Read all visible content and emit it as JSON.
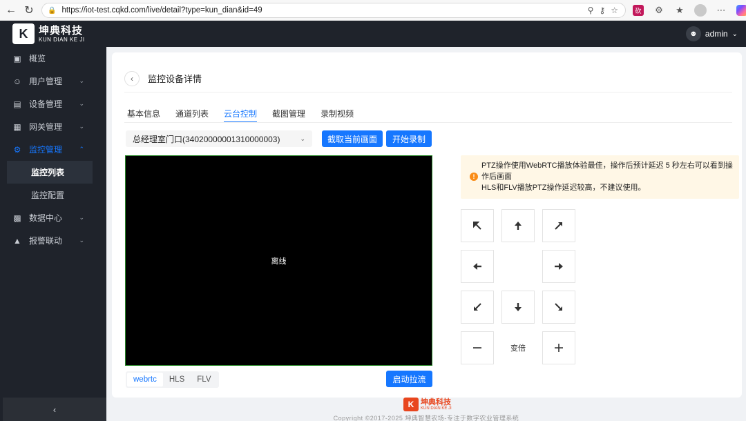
{
  "browser": {
    "url": "https://iot-test.cqkd.com/live/detail?type=kun_dian&id=49",
    "extension_badge": "砍"
  },
  "header": {
    "logo_mark": "K",
    "logo_cn": "坤典科技",
    "logo_en": "KUN DIAN KE JI",
    "user_name": "admin"
  },
  "sidebar": {
    "items": [
      {
        "label": "概览",
        "icon": "dashboard-icon"
      },
      {
        "label": "用户管理",
        "icon": "user-icon"
      },
      {
        "label": "设备管理",
        "icon": "device-icon"
      },
      {
        "label": "网关管理",
        "icon": "gateway-icon"
      },
      {
        "label": "监控管理",
        "icon": "monitor-icon"
      },
      {
        "label": "数据中心",
        "icon": "chart-icon"
      },
      {
        "label": "报警联动",
        "icon": "alarm-icon"
      }
    ],
    "sub_items": [
      "监控列表",
      "监控配置"
    ],
    "collapse": "‹"
  },
  "page": {
    "title": "监控设备详情",
    "tabs": [
      "基本信息",
      "通道列表",
      "云台控制",
      "截图管理",
      "录制视频"
    ],
    "active_tab": "云台控制"
  },
  "controls": {
    "channel_select": "总经理室门口(34020000001310000003)",
    "capture_button": "截取当前画面",
    "record_button": "开始录制",
    "video_status": "离线",
    "protocols": [
      "webrtc",
      "HLS",
      "FLV"
    ],
    "active_protocol": "webrtc",
    "start_stream_button": "启动拉流"
  },
  "alert": {
    "line1": "PTZ操作使用WebRTC播放体验最佳，操作后预计延迟 5 秒左右可以看到操作后画面",
    "line2": "HLS和FLV播放PTZ操作延迟较高，不建议使用。"
  },
  "ptz": {
    "zoom_label": "变倍"
  },
  "footer": {
    "logo_cn": "坤典科技",
    "logo_en": "KUN DIAN KE JI",
    "copyright": "Copyright ©2017-2025 坤典智慧农场-专注于数字农业管理系统"
  }
}
